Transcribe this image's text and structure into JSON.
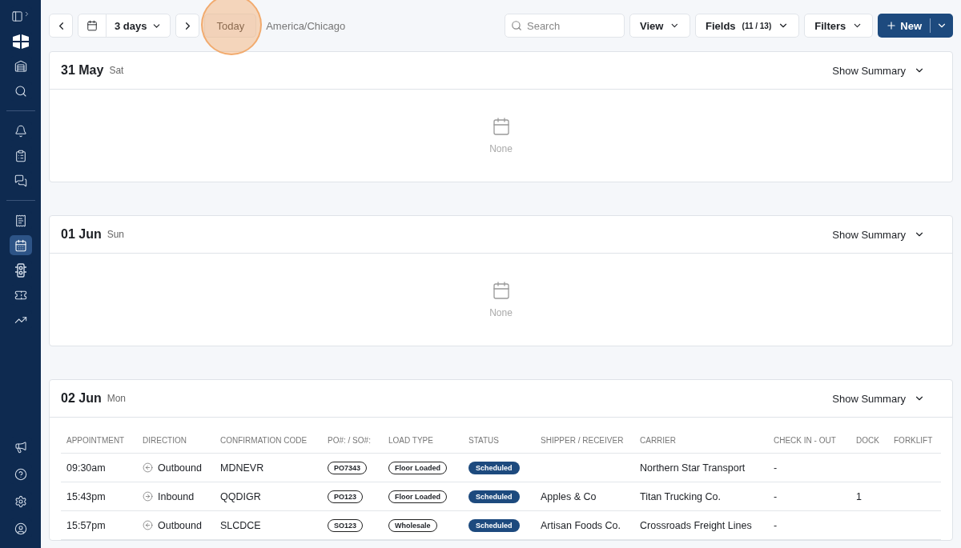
{
  "sidebar": {
    "groups": [
      [
        {
          "kind": "toggle",
          "selected": false
        },
        {
          "kind": "logo",
          "selected": false
        },
        {
          "kind": "warehouse",
          "selected": false
        },
        {
          "kind": "search",
          "selected": false
        }
      ],
      [
        {
          "kind": "bell",
          "selected": false
        },
        {
          "kind": "clipboard",
          "selected": false
        },
        {
          "kind": "chat",
          "selected": false
        }
      ],
      [
        {
          "kind": "ledger",
          "selected": false
        },
        {
          "kind": "calendar",
          "selected": true
        },
        {
          "kind": "traffic",
          "selected": false
        },
        {
          "kind": "ticket",
          "selected": false
        },
        {
          "kind": "chart",
          "selected": false
        }
      ]
    ],
    "bottom_items": [
      {
        "kind": "megaphone",
        "selected": false
      },
      {
        "kind": "help",
        "selected": false
      },
      {
        "kind": "settings",
        "selected": false
      },
      {
        "kind": "user",
        "selected": false
      }
    ]
  },
  "toolbar": {
    "range": "3 days",
    "today": "Today",
    "timezone": "America/Chicago",
    "search": {
      "placeholder": "Search"
    },
    "view": "View",
    "fields": {
      "label": "Fields",
      "count": "(11 / 13)"
    },
    "filters": "Filters",
    "new": "New"
  },
  "days": [
    {
      "date": "31 May",
      "weekday": "Sat",
      "summary": "Show Summary",
      "empty": "None"
    },
    {
      "date": "01 Jun",
      "weekday": "Sun",
      "summary": "Show Summary",
      "empty": "None"
    },
    {
      "date": "02 Jun",
      "weekday": "Mon",
      "summary": "Show Summary",
      "columns": [
        "APPOINTMENT",
        "DIRECTION",
        "CONFIRMATION CODE",
        "PO#: / SO#:",
        "LOAD TYPE",
        "STATUS",
        "SHIPPER / RECEIVER",
        "CARRIER",
        "CHECK IN - OUT",
        "DOCK",
        "FORKLIFT"
      ],
      "rows": [
        {
          "appointment": "09:30am",
          "direction": {
            "kind": "outbound",
            "label": "Outbound"
          },
          "code": "MDNEVR",
          "po": "PO7343",
          "load_type": "Floor Loaded",
          "status": "Scheduled",
          "carrier": "Northern Star Transport",
          "check": "-"
        },
        {
          "appointment": "15:43pm",
          "direction": {
            "kind": "inbound",
            "label": "Inbound"
          },
          "code": "QQDIGR",
          "po": "PO123",
          "load_type": "Floor Loaded",
          "status": "Scheduled",
          "shipper": "Apples & Co",
          "carrier": "Titan Trucking Co.",
          "check": "-",
          "dock": "1"
        },
        {
          "appointment": "15:57pm",
          "direction": {
            "kind": "outbound",
            "label": "Outbound"
          },
          "code": "SLCDCE",
          "po": "SO123",
          "load_type": "Wholesale",
          "status": "Scheduled",
          "shipper": "Artisan Foods Co.",
          "carrier": "Crossroads Freight Lines",
          "check": "-"
        }
      ]
    }
  ]
}
